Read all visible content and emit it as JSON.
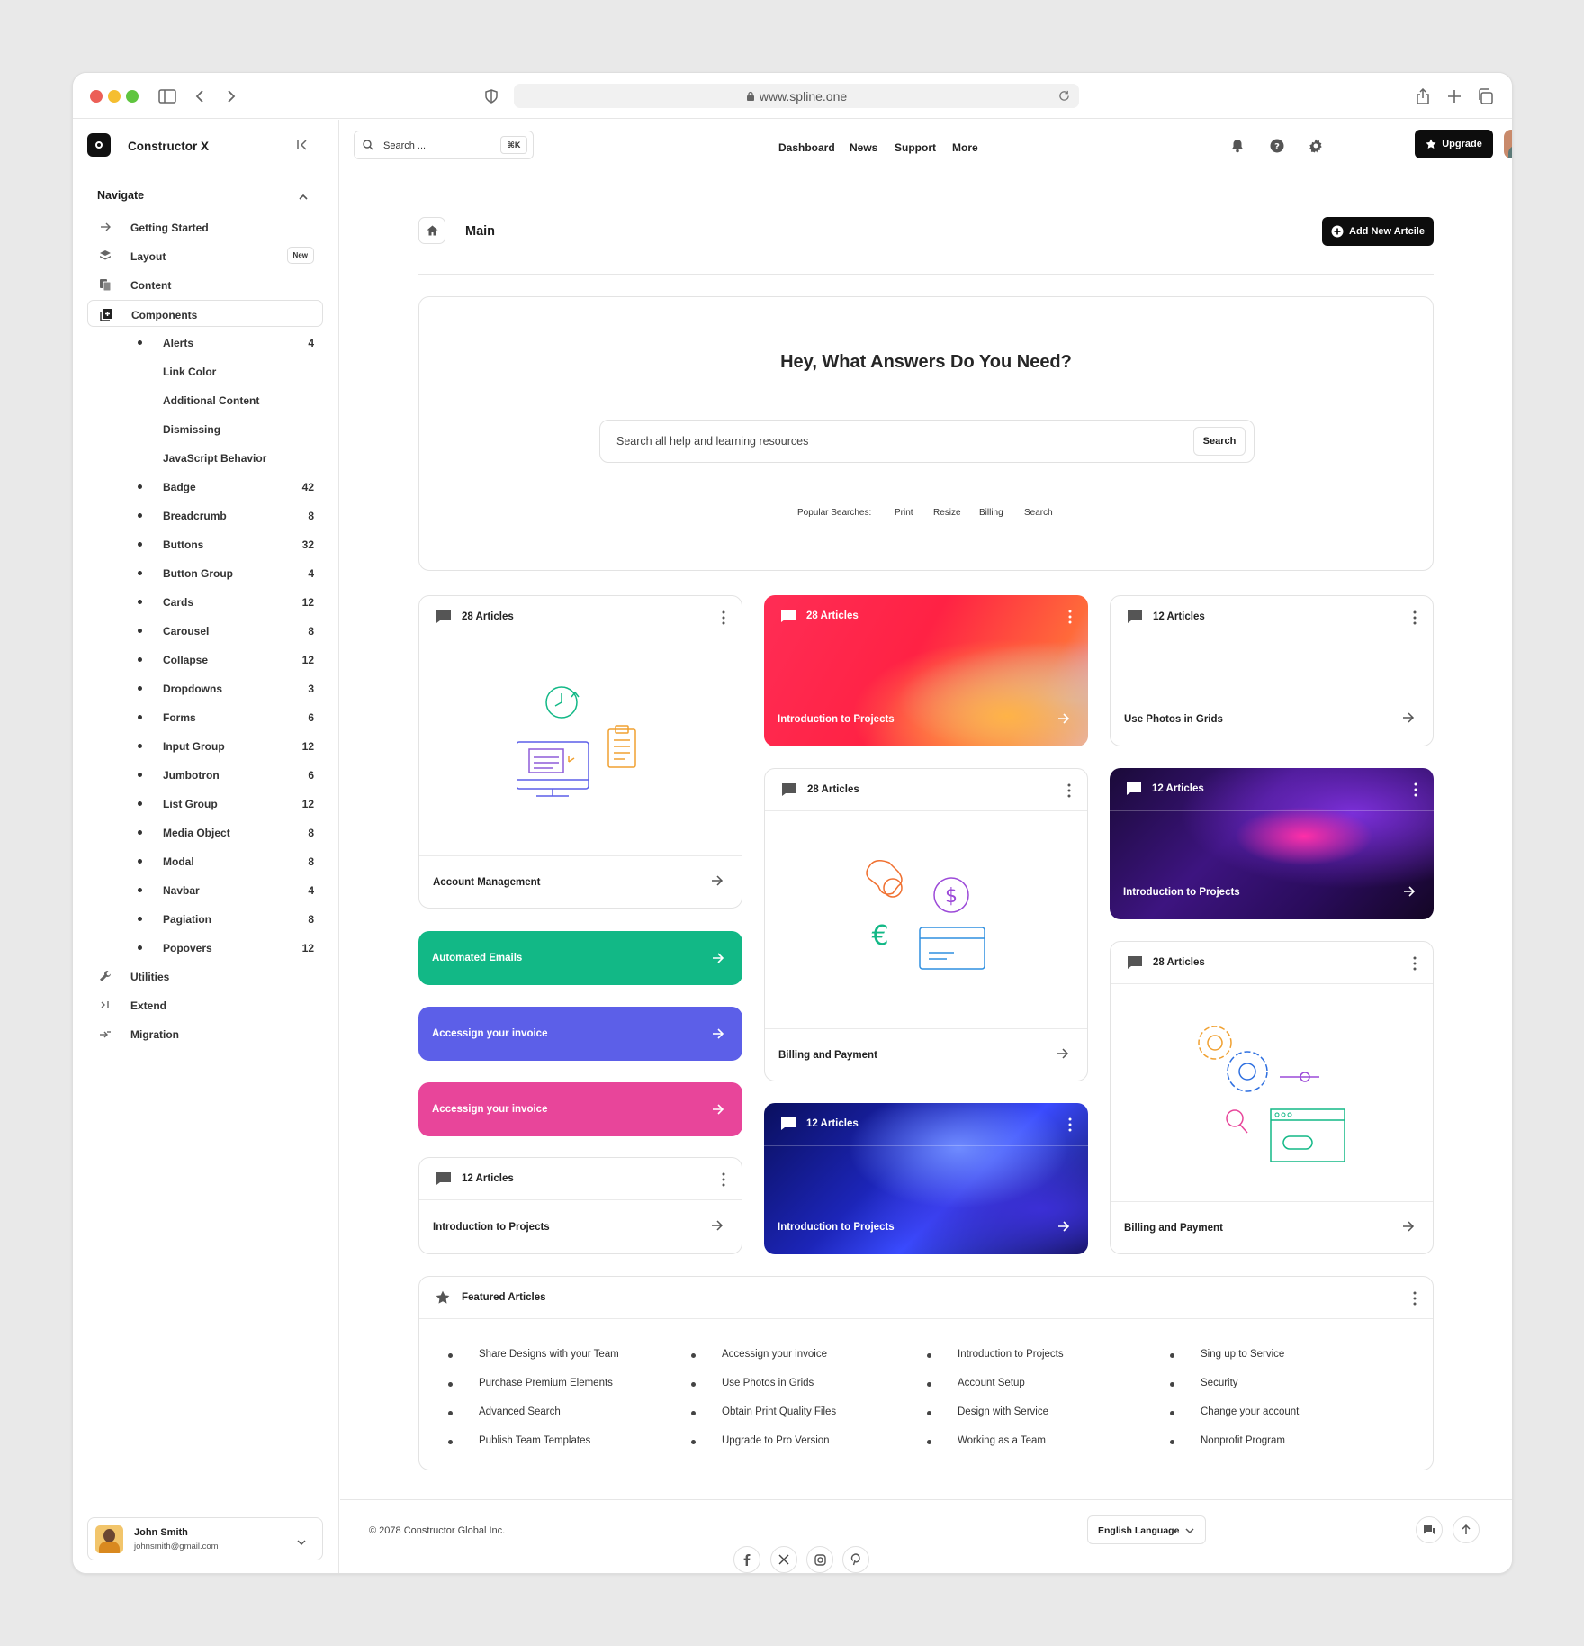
{
  "browser": {
    "url": "www.spline.one"
  },
  "app": {
    "name": "Constructor X"
  },
  "sidebar": {
    "section_title": "Navigate",
    "items": [
      {
        "label": "Getting Started",
        "icon": "arrow-right-icon"
      },
      {
        "label": "Layout",
        "icon": "layers-icon",
        "badge": "New"
      },
      {
        "label": "Content",
        "icon": "copy-icon"
      },
      {
        "label": "Components",
        "icon": "plus-square-icon"
      }
    ],
    "sub_items": [
      {
        "label": "Alerts",
        "count": "4",
        "bullet": true
      },
      {
        "label": "Link Color",
        "count": "",
        "bullet": false
      },
      {
        "label": "Additional Content",
        "count": "",
        "bullet": false
      },
      {
        "label": "Dismissing",
        "count": "",
        "bullet": false
      },
      {
        "label": "JavaScript Behavior",
        "count": "",
        "bullet": false
      },
      {
        "label": "Badge",
        "count": "42",
        "bullet": true
      },
      {
        "label": "Breadcrumb",
        "count": "8",
        "bullet": true
      },
      {
        "label": "Buttons",
        "count": "32",
        "bullet": true
      },
      {
        "label": "Button Group",
        "count": "4",
        "bullet": true
      },
      {
        "label": "Cards",
        "count": "12",
        "bullet": true
      },
      {
        "label": "Carousel",
        "count": "8",
        "bullet": true
      },
      {
        "label": "Collapse",
        "count": "12",
        "bullet": true
      },
      {
        "label": "Dropdowns",
        "count": "3",
        "bullet": true
      },
      {
        "label": "Forms",
        "count": "6",
        "bullet": true
      },
      {
        "label": "Input Group",
        "count": "12",
        "bullet": true
      },
      {
        "label": "Jumbotron",
        "count": "6",
        "bullet": true
      },
      {
        "label": "List Group",
        "count": "12",
        "bullet": true
      },
      {
        "label": "Media Object",
        "count": "8",
        "bullet": true
      },
      {
        "label": "Modal",
        "count": "8",
        "bullet": true
      },
      {
        "label": "Navbar",
        "count": "4",
        "bullet": true
      },
      {
        "label": "Pagiation",
        "count": "8",
        "bullet": true
      },
      {
        "label": "Popovers",
        "count": "12",
        "bullet": true
      }
    ],
    "bottom_items": [
      {
        "label": "Utilities",
        "icon": "wrench-icon"
      },
      {
        "label": "Extend",
        "icon": "extend-icon"
      },
      {
        "label": "Migration",
        "icon": "migration-icon"
      }
    ],
    "user": {
      "name": "John Smith",
      "email": "johnsmith@gmail.com"
    }
  },
  "topbar": {
    "search_placeholder": "Search ...",
    "shortcut": "⌘K",
    "nav": [
      "Dashboard",
      "News",
      "Support",
      "More"
    ],
    "upgrade_label": "Upgrade"
  },
  "page": {
    "title": "Main",
    "add_button": "Add New Artcile"
  },
  "hero": {
    "heading": "Hey, What Answers Do You Need?",
    "search_placeholder": "Search all help and learning resources",
    "search_button": "Search",
    "popular_label": "Popular Searches:",
    "popular": [
      "Print",
      "Resize",
      "Billing",
      "Search"
    ]
  },
  "cards": {
    "c1": {
      "count": "28 Articles",
      "title": "Account Management"
    },
    "c2": {
      "count": "28 Articles",
      "title": "Introduction to Projects"
    },
    "c3": {
      "count": "12 Articles",
      "title": "Use Photos in Grids"
    },
    "c4": {
      "count": "28 Articles",
      "title": "Billing and Payment"
    },
    "c5": {
      "count": "12 Articles",
      "title": "Introduction to Projects"
    },
    "c6": {
      "title": "Automated Emails"
    },
    "c7": {
      "title": "Accessign your invoice"
    },
    "c8": {
      "title": "Accessign your invoice"
    },
    "c9": {
      "count": "28 Articles",
      "title": "Billing and Payment"
    },
    "c10": {
      "count": "12 Articles",
      "title": "Introduction to Projects"
    },
    "c11": {
      "count": "12 Articles",
      "title": "Introduction to Projects"
    }
  },
  "colors": {
    "green": "#12b886",
    "indigo": "#5c5fe8",
    "pink": "#e8459a"
  },
  "featured": {
    "title": "Featured Articles",
    "columns": [
      [
        "Share Designs with your Team",
        "Purchase Premium Elements",
        "Advanced Search",
        "Publish Team Templates"
      ],
      [
        "Accessign your invoice",
        "Use Photos in Grids",
        "Obtain Print Quality Files",
        "Upgrade to Pro Version"
      ],
      [
        "Introduction to Projects",
        "Account Setup",
        "Design with Service",
        "Working as a Team"
      ],
      [
        "Sing up to Service",
        "Security",
        "Change your account",
        "Nonprofit Program"
      ]
    ]
  },
  "footer": {
    "copyright": "© 2078 Constructor Global Inc.",
    "language": "English Language",
    "socials": [
      "facebook-icon",
      "x-icon",
      "instagram-icon",
      "pinterest-icon"
    ]
  }
}
